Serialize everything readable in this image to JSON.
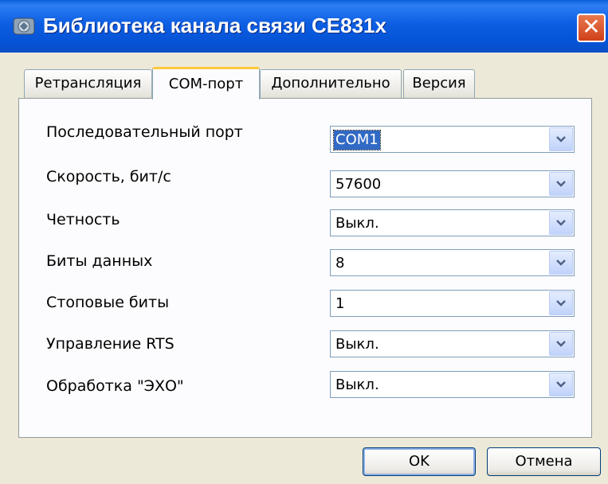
{
  "window": {
    "title": "Библиотека канала связи CE831x",
    "close_symbol": "✕"
  },
  "tabs": [
    {
      "label": "Ретрансляция",
      "active": false
    },
    {
      "label": "COM-порт",
      "active": true
    },
    {
      "label": "Дополнительно",
      "active": false
    },
    {
      "label": "Версия",
      "active": false
    }
  ],
  "settings": [
    {
      "label": "Последовательный порт",
      "value": "COM1"
    },
    {
      "label": "Скорость, бит/с",
      "value": "57600"
    },
    {
      "label": "Четность",
      "value": "Выкл."
    },
    {
      "label": "Биты данных",
      "value": "8"
    },
    {
      "label": "Стоповые биты",
      "value": "1"
    },
    {
      "label": "Управление RTS",
      "value": "Выкл."
    },
    {
      "label": "Обработка \"ЭХО\"",
      "value": "Выкл."
    }
  ],
  "buttons": {
    "ok": "OK",
    "cancel": "Отмена"
  },
  "icons": {
    "app": "app-icon",
    "close": "close-icon",
    "dropdown": "chevron-down-icon"
  },
  "colors": {
    "titlebar": "#0553d6",
    "close_button": "#d0411a",
    "dialog_background": "#ece9d8",
    "active_tab_accent": "#ffc83c",
    "selection": "#316ac5"
  }
}
